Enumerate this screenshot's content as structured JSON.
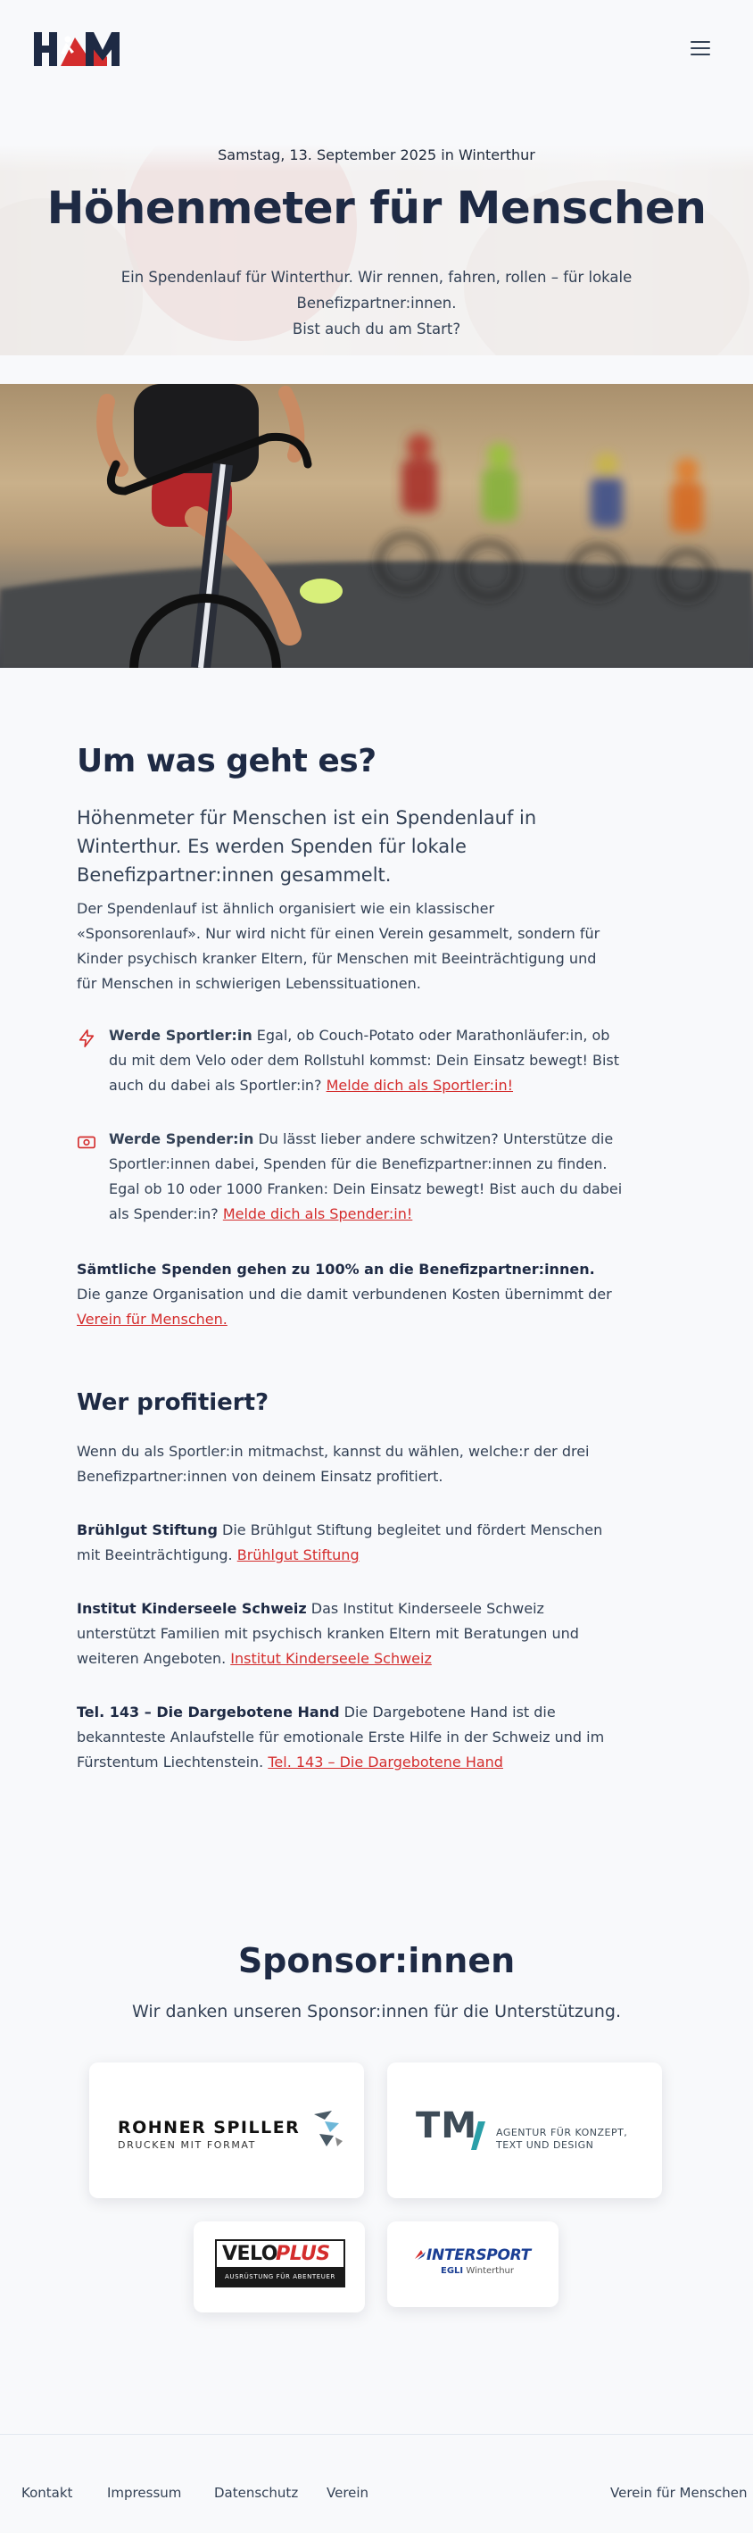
{
  "header": {
    "logo_alt": "HfM",
    "menu_icon": "hamburger-menu-icon"
  },
  "hero": {
    "date_line": "Samstag, 13. September 2025 in Winterthur",
    "title": "Höhenmeter für Menschen",
    "subtitle_line1": "Ein Spendenlauf für Winterthur. Wir rennen, fahren, rollen – für lokale Benefizpartner:innen.",
    "subtitle_line2": "Bist auch du am Start?"
  },
  "about": {
    "heading": "Um was geht es?",
    "lead": "Höhenmeter für Menschen ist ein Spendenlauf in Winterthur. Es werden Spenden für lokale Benefizpartner:innen gesammelt.",
    "body": "Der Spendenlauf ist ähnlich organisiert wie ein klassischer «Sponsorenlauf». Nur wird nicht für einen Verein gesammelt, sondern für Kinder psychisch kranker Eltern, für Menschen mit Beeinträchtigung und für Menschen in schwierigen Lebenssituationen.",
    "features": [
      {
        "icon": "lightning-icon",
        "title": "Werde Sportler:in",
        "text": " Egal, ob Couch-Potato oder Marathonläufer:in, ob du mit dem Velo oder dem Rollstuhl kommst: Dein Einsatz bewegt! Bist auch du dabei als Sportler:in? ",
        "link": "Melde dich als Sportler:in!"
      },
      {
        "icon": "banknote-icon",
        "title": "Werde Spender:in",
        "text": " Du lässt lieber andere schwitzen? Unterstütze die Sportler:innen dabei, Spenden für die Benefizpartner:innen zu finden. Egal ob 10 oder 1000 Franken: Dein Einsatz bewegt! Bist auch du dabei als Spender:in? ",
        "link": "Melde dich als Spender:in!"
      }
    ],
    "note_bold": "Sämtliche Spenden gehen zu 100% an die Benefizpartner:innen.",
    "note_text": " Die ganze Organisation und die damit verbundenen Kosten übernimmt der ",
    "note_link": "Verein für Menschen."
  },
  "beneficiaries": {
    "heading": "Wer profitiert?",
    "intro": "Wenn du als Sportler:in mitmachst, kannst du wählen, welche:r der drei Benefizpartner:innen von deinem Einsatz profitiert.",
    "items": [
      {
        "name": "Brühlgut Stiftung",
        "text": " Die Brühlgut Stiftung begleitet und fördert Menschen mit Beeinträchtigung. ",
        "link": "Brühlgut Stiftung"
      },
      {
        "name": "Institut Kinderseele Schweiz",
        "text": " Das Institut Kinderseele Schweiz unterstützt Familien mit psychisch kranken Eltern mit Beratungen und weiteren Angeboten. ",
        "link": "Institut Kinderseele Schweiz"
      },
      {
        "name": "Tel. 143 – Die Dargebotene Hand",
        "text": " Die Dargebotene Hand ist die bekannteste Anlaufstelle für emotionale Erste Hilfe in der Schweiz und im Fürstentum Liechtenstein. ",
        "link": "Tel. 143 – Die Dargebotene Hand"
      }
    ]
  },
  "sponsors": {
    "heading": "Sponsor:innen",
    "subtitle": "Wir danken unseren Sponsor:innen für die Unterstützung.",
    "rohner": {
      "name": "ROHNER SPILLER",
      "tagline": "DRUCKEN MIT FORMAT"
    },
    "tm": {
      "mark": "TM",
      "line1": "AGENTUR FÜR KONZEPT,",
      "line2": "TEXT UND DESIGN"
    },
    "veloplus": {
      "velo": "VELO",
      "plus": "PLUS",
      "tagline": "AUSRÜSTUNG FÜR ABENTEUER"
    },
    "intersport": {
      "name": "INTERSPORT",
      "store_bold": "EGLI",
      "store_city": "Winterthur"
    }
  },
  "footer": {
    "links": [
      "Kontakt",
      "Impressum",
      "Datenschutz",
      "Verein"
    ],
    "right": "Verein für Menschen"
  },
  "colors": {
    "accent": "#d42d2d",
    "navy": "#1e2a44",
    "text": "#334155",
    "bg": "#f8f9fb"
  }
}
